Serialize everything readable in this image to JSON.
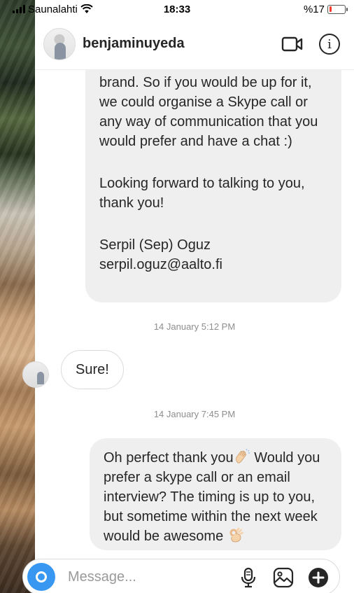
{
  "status_bar": {
    "carrier": "Saunalahti",
    "time": "18:33",
    "battery_percent": "%17",
    "battery_level": 0.17
  },
  "header": {
    "username": "benjaminuyeda",
    "icons": [
      "video-call-icon",
      "info-icon"
    ]
  },
  "messages": {
    "incoming_long": {
      "lines_p1": "brand. So if you would be up for it, we could organise a Skype call or any way of communication that you would prefer and have a chat :)",
      "lines_p2": "Looking forward to talking to you, thank you!",
      "signature_name": "Serpil (Sep) Oguz",
      "signature_email": "serpil.oguz@aalto.fi"
    },
    "timestamp_1": "14 January 5:12 PM",
    "reply": "Sure!",
    "timestamp_2": "14 January 7:45 PM",
    "outgoing": {
      "text_a": "Oh perfect thank you",
      "text_b": " Would you prefer a skype call or an email interview? The timing is up to you, but sometime within the next week would be awesome "
    }
  },
  "composer": {
    "placeholder": "Message...",
    "icons": [
      "camera-icon",
      "microphone-icon",
      "gallery-icon",
      "plus-icon"
    ]
  },
  "colors": {
    "accent": "#3897f0",
    "bubble_bg": "#efefef",
    "battery_low": "#ff3b30"
  }
}
